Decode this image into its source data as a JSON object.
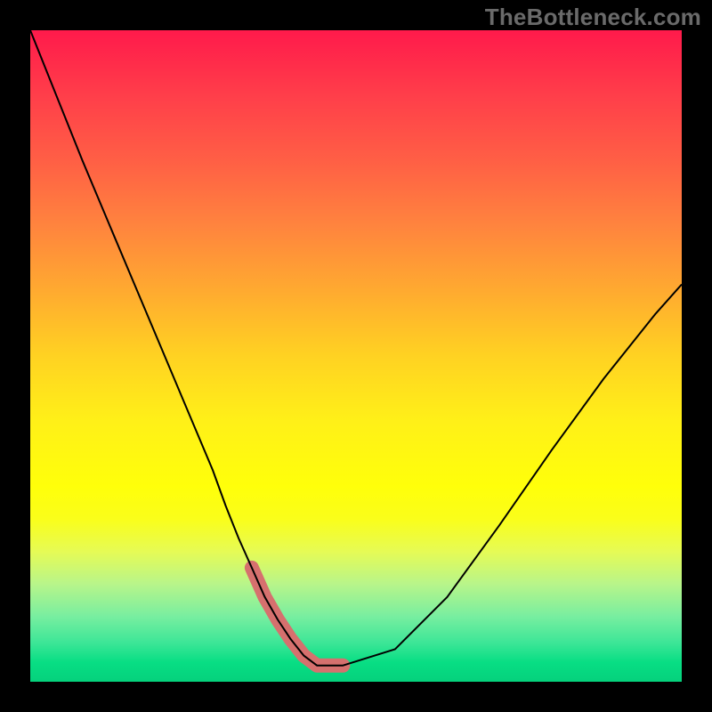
{
  "watermark": "TheBottleneck.com",
  "chart_data": {
    "type": "line",
    "title": "",
    "xlabel": "",
    "ylabel": "",
    "xlim": [
      0,
      100
    ],
    "ylim": [
      0,
      100
    ],
    "grid": false,
    "legend": false,
    "annotations": [],
    "series": [
      {
        "name": "curve",
        "x": [
          0,
          4,
          8,
          12,
          16,
          20,
          24,
          28,
          30,
          32,
          34,
          36,
          38,
          40,
          42,
          44,
          48,
          56,
          64,
          72,
          80,
          88,
          96,
          100
        ],
        "y": [
          100,
          90,
          80,
          70.5,
          61,
          51.5,
          42,
          32.5,
          27,
          22,
          17.5,
          13,
          9.5,
          6.5,
          4,
          2.5,
          2.5,
          5,
          13,
          24,
          35.5,
          46.5,
          56.5,
          61
        ],
        "stroke": "#000000"
      },
      {
        "name": "highlight-bottom",
        "x": [
          34,
          36,
          38,
          40,
          42,
          44,
          48
        ],
        "y": [
          17.5,
          13,
          9.5,
          6.5,
          4,
          2.5,
          2.5
        ],
        "stroke": "#d6706e"
      }
    ],
    "gradient_stops": [
      {
        "pos": 0,
        "color": "#ff1a4b"
      },
      {
        "pos": 10,
        "color": "#ff3e4a"
      },
      {
        "pos": 20,
        "color": "#ff5f45"
      },
      {
        "pos": 30,
        "color": "#ff843e"
      },
      {
        "pos": 40,
        "color": "#ffaa30"
      },
      {
        "pos": 50,
        "color": "#ffd222"
      },
      {
        "pos": 60,
        "color": "#fff018"
      },
      {
        "pos": 70,
        "color": "#ffff0a"
      },
      {
        "pos": 80,
        "color": "#e6fb55"
      },
      {
        "pos": 90,
        "color": "#78eea0"
      },
      {
        "pos": 97,
        "color": "#08de84"
      },
      {
        "pos": 100,
        "color": "#05d17c"
      }
    ]
  }
}
